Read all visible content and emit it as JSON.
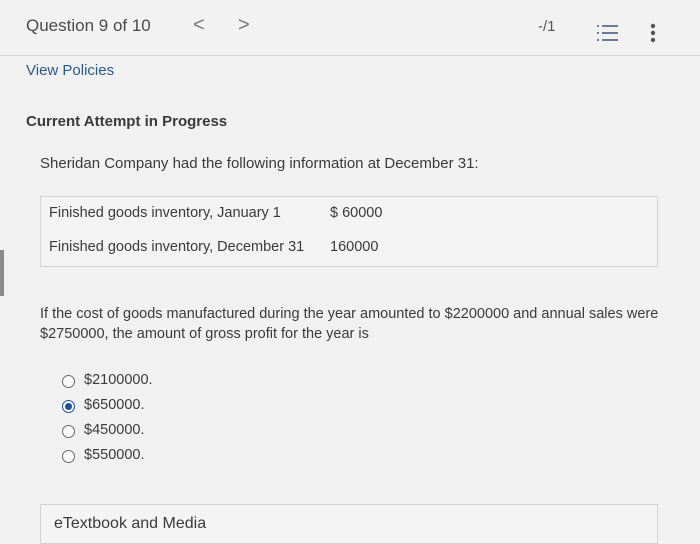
{
  "header": {
    "question_counter": "Question 9 of 10",
    "prev_symbol": "<",
    "next_symbol": ">",
    "score": "-/1",
    "icons": [
      "list-icon",
      "more-vertical-icon"
    ]
  },
  "policies_link": "View Policies",
  "attempt_status": "Current Attempt in Progress",
  "stem": "Sheridan Company had the following information at December 31:",
  "info_table": {
    "rows": [
      {
        "label": "Finished goods inventory, January 1",
        "value": "$ 60000"
      },
      {
        "label": "Finished goods inventory, December 31",
        "value": "160000"
      }
    ]
  },
  "question_text": "If the cost of goods manufactured during the year amounted to $2200000 and annual sales were $2750000, the amount of gross profit for the year is",
  "options": [
    {
      "label": "$2100000.",
      "selected": false
    },
    {
      "label": "$650000.",
      "selected": true
    },
    {
      "label": "$450000.",
      "selected": false
    },
    {
      "label": "$550000.",
      "selected": false
    }
  ],
  "etextbook_label": "eTextbook and Media"
}
